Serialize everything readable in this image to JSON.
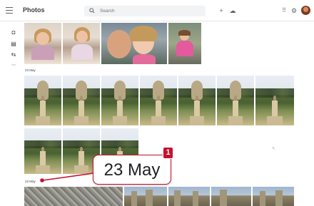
{
  "header": {
    "app_title": "Photos",
    "search_placeholder": "Search",
    "icons": [
      "menu-icon",
      "search-icon",
      "add-icon",
      "upload-icon",
      "apps-grid-icon",
      "settings-icon",
      "account-avatar"
    ]
  },
  "sidebar": {
    "icons": [
      "photos-icon",
      "albums-icon",
      "sharing-icon",
      "more-icon"
    ]
  },
  "sections": [
    {
      "date": "",
      "photo_count": 4
    },
    {
      "date": "23 May",
      "photo_count": 10
    },
    {
      "date": "23 May",
      "photo_count": 5
    }
  ],
  "callout": {
    "badge": "1",
    "text": "23 May"
  },
  "colors": {
    "accent": "#c8102e",
    "topbar_bg": "#ffffff",
    "search_bg": "#f1f3f4"
  }
}
